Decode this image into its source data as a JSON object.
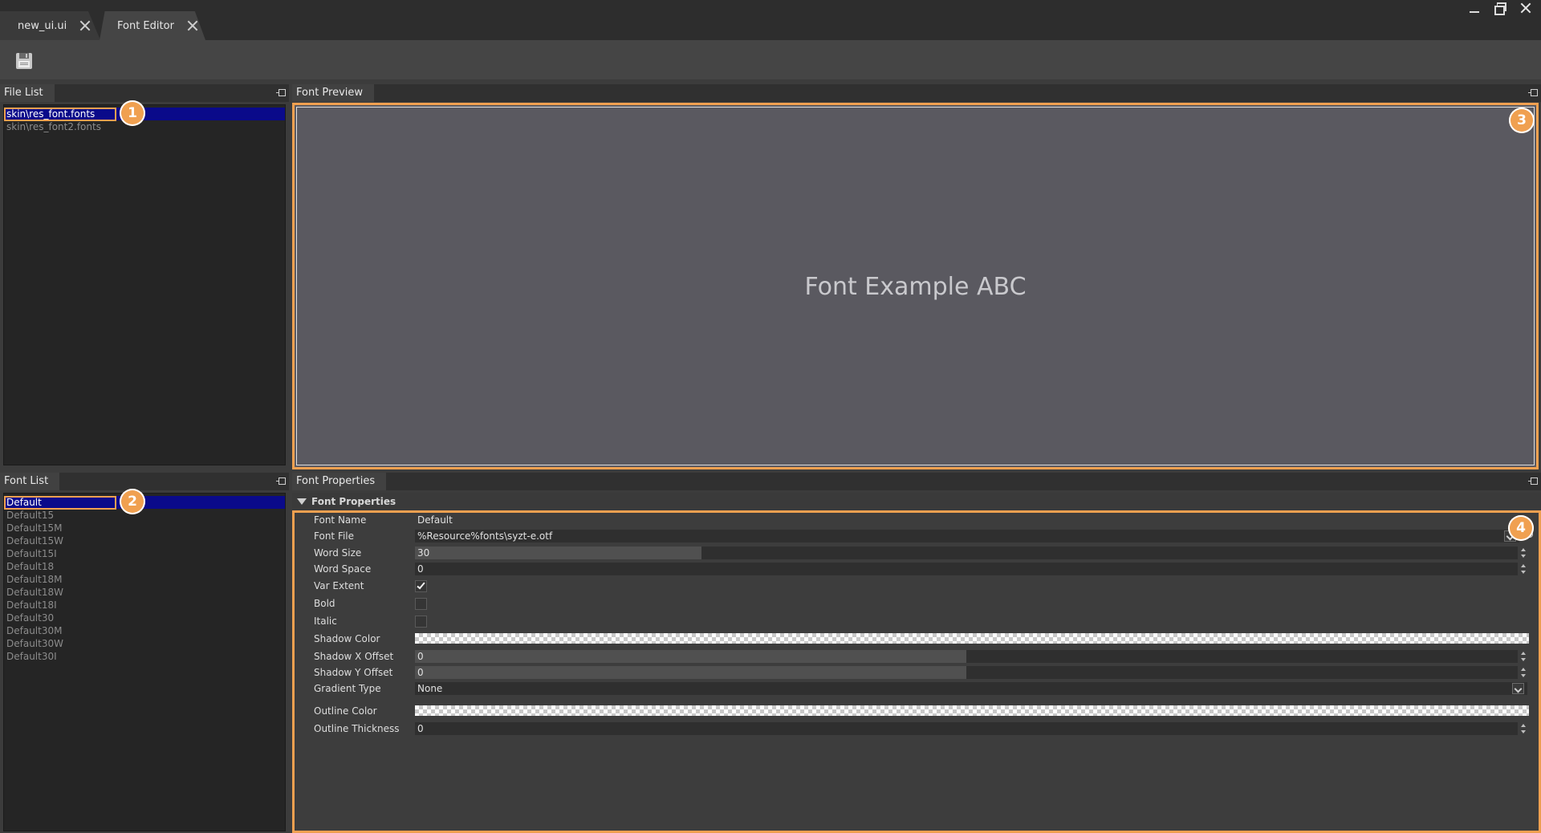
{
  "tabs": [
    {
      "label": "new_ui.ui",
      "active": false
    },
    {
      "label": "Font Editor",
      "active": true
    }
  ],
  "toolbar": {
    "save_icon": "save-icon"
  },
  "file_list": {
    "title": "File List",
    "items": [
      "skin\\res_font.fonts",
      "skin\\res_font2.fonts"
    ],
    "selected_index": 0,
    "badge": "1"
  },
  "font_list": {
    "title": "Font List",
    "items": [
      "Default",
      "Default15",
      "Default15M",
      "Default15W",
      "Default15I",
      "Default18",
      "Default18M",
      "Default18W",
      "Default18I",
      "Default30",
      "Default30M",
      "Default30W",
      "Default30I"
    ],
    "selected_index": 0,
    "badge": "2"
  },
  "preview": {
    "title": "Font Preview",
    "sample_text": "Font Example ABC",
    "badge": "3"
  },
  "properties": {
    "panel_title": "Font Properties",
    "section_title": "Font Properties",
    "badge": "4",
    "font_name_label": "Font Name",
    "font_name_value": "Default",
    "font_file_label": "Font File",
    "font_file_value": "%Resource%fonts\\syzt-e.otf",
    "word_size_label": "Word Size",
    "word_size_value": "30",
    "word_size_fill": 0.26,
    "word_space_label": "Word Space",
    "word_space_value": "0",
    "var_extent_label": "Var Extent",
    "var_extent_checked": true,
    "bold_label": "Bold",
    "bold_checked": false,
    "italic_label": "Italic",
    "italic_checked": false,
    "shadow_color_label": "Shadow Color",
    "shadow_x_label": "Shadow X Offset",
    "shadow_x_value": "0",
    "shadow_x_fill": 0.5,
    "shadow_y_label": "Shadow Y Offset",
    "shadow_y_value": "0",
    "shadow_y_fill": 0.5,
    "gradient_type_label": "Gradient Type",
    "gradient_type_value": "None",
    "outline_color_label": "Outline Color",
    "outline_thickness_label": "Outline Thickness",
    "outline_thickness_value": "0"
  }
}
